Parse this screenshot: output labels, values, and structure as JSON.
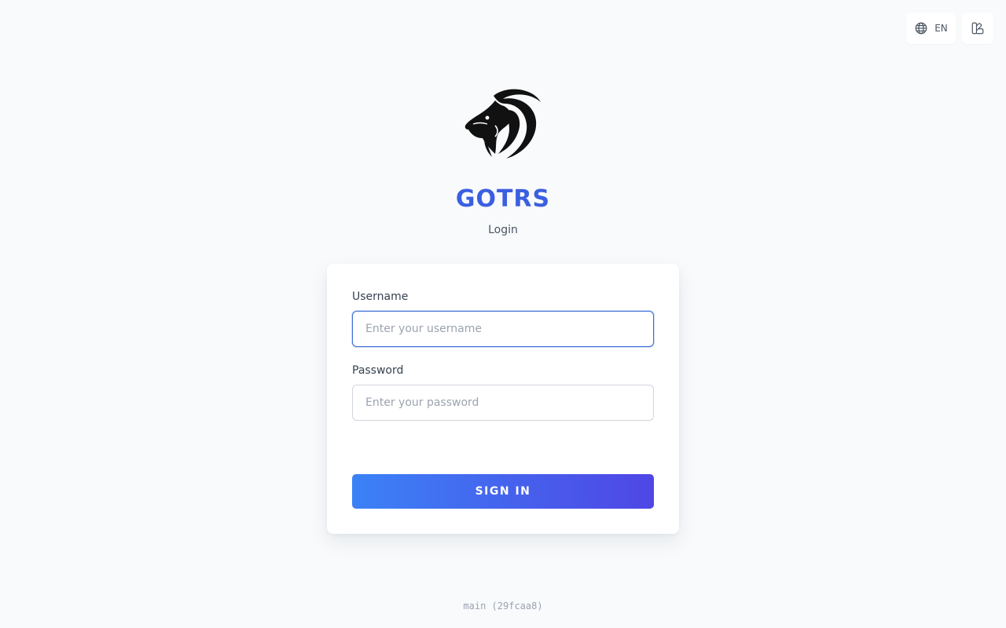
{
  "header": {
    "language_label": "EN",
    "language_icon": "globe-icon",
    "theme_icon": "theme-palette-icon"
  },
  "brand": {
    "name": "GOTRS",
    "subtitle": "Login",
    "logo": "goat-logo",
    "color": "#3b5fe0"
  },
  "form": {
    "username_label": "Username",
    "username_placeholder": "Enter your username",
    "username_value": "",
    "password_label": "Password",
    "password_placeholder": "Enter your password",
    "password_value": "",
    "submit_label": "SIGN IN",
    "button_gradient": [
      "#3b82f6",
      "#4f46e5"
    ]
  },
  "footer": {
    "version": "main (29fcaa8)"
  }
}
